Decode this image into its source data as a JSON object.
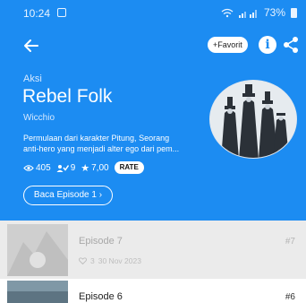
{
  "status_bar": {
    "time": "10:24",
    "battery": "73%"
  },
  "header": {
    "favorite_label": "+Favorit",
    "info_label": "i"
  },
  "series": {
    "genre": "Aksi",
    "title": "Rebel Folk",
    "author": "Wicchio",
    "synopsis_line1": "Permulaan dari karakter Pitung, Seorang",
    "synopsis_line2": "anti-hero yang menjadi alter ego dari pem...",
    "views": "405",
    "subscribers": "9",
    "rating": "7,00",
    "rate_label": "RATE",
    "read_button": "Baca Episode 1 ›"
  },
  "episodes": [
    {
      "title": "Episode 7",
      "likes": "3",
      "date": "30 Nov 2023",
      "number": "#7"
    },
    {
      "title": "Episode 6",
      "number": "#6"
    }
  ],
  "colors": {
    "accent": "#1c8cf2",
    "dim_row": "#ebebeb"
  }
}
